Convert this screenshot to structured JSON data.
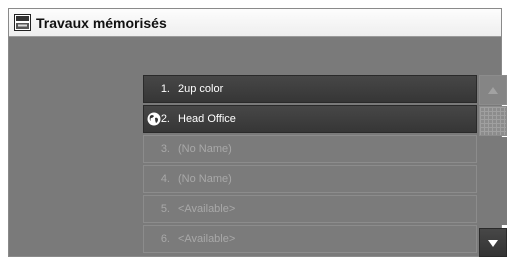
{
  "window": {
    "title": "Travaux mémorisés",
    "title_icon": "stored-jobs-icon"
  },
  "jobs": [
    {
      "num": "1.",
      "name": "2up color",
      "state": "active",
      "icon": ""
    },
    {
      "num": "2.",
      "name": "Head Office",
      "state": "active",
      "icon": "globe-icon"
    },
    {
      "num": "3.",
      "name": "(No Name)",
      "state": "inactive",
      "icon": ""
    },
    {
      "num": "4.",
      "name": "(No Name)",
      "state": "inactive",
      "icon": ""
    },
    {
      "num": "5.",
      "name": "<Available>",
      "state": "inactive",
      "icon": ""
    },
    {
      "num": "6.",
      "name": "<Available>",
      "state": "inactive",
      "icon": ""
    }
  ],
  "scrollbar": {
    "up_icon": "scroll-up-icon",
    "down_icon": "scroll-down-icon"
  },
  "colors": {
    "active_row": "#3f3f3f",
    "inactive_row": "#7b7b7b",
    "background": "#7a7a7a"
  }
}
